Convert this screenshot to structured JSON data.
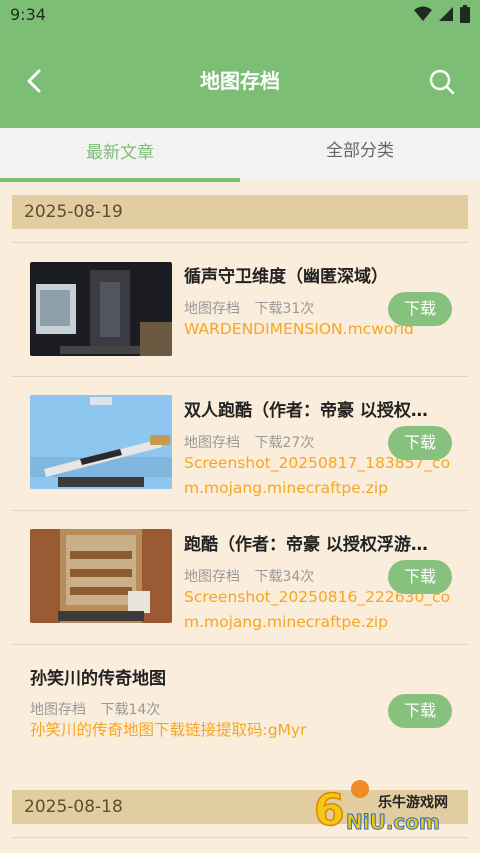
{
  "status": {
    "time": "9:34"
  },
  "header": {
    "title": "地图存档"
  },
  "tabs": [
    {
      "label": "最新文章"
    },
    {
      "label": "全部分类"
    }
  ],
  "sections": [
    {
      "date": "2025-08-19",
      "items": [
        {
          "title": "循声守卫维度（幽匿深域）",
          "category": "地图存档",
          "downloads": "下载31次",
          "file": "WARDENDIMENSION.mcworld",
          "button": "下载"
        },
        {
          "title": "双人跑酷（作者：帝豪 以授权…",
          "category": "地图存档",
          "downloads": "下载27次",
          "file": "Screenshot_20250817_183857_com.mojang.minecraftpe.zip",
          "button": "下载"
        },
        {
          "title": "跑酷（作者：帝豪 以授权浮游…",
          "category": "地图存档",
          "downloads": "下载34次",
          "file": "Screenshot_20250816_222630_com.mojang.minecraftpe.zip",
          "button": "下载"
        },
        {
          "title": "孙笑川的传奇地图",
          "category": "地图存档",
          "downloads": "下载14次",
          "file": "孙笑川的传奇地图下载链接提取码:gMyr",
          "button": "下载"
        }
      ]
    },
    {
      "date": "2025-08-18"
    }
  ],
  "watermark": {
    "text": "乐牛游戏网",
    "brand": "NiU.com"
  },
  "colors": {
    "primary": "#7dbe76",
    "accent": "#f5a623",
    "background": "#fbeddb",
    "date_bar": "#e2cda0"
  }
}
